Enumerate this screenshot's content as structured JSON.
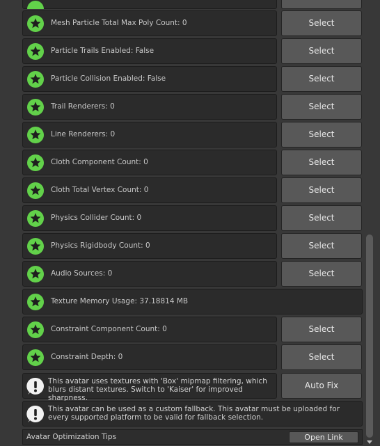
{
  "colors": {
    "ok_green": "#62d14a",
    "star": "#1e1e1e",
    "row_bg": "#2b2b2b",
    "button_bg": "#585858",
    "warn_circle": "#f2f2f2"
  },
  "rows": [
    {
      "label": "Mesh Particle Total Max Poly Count: 0",
      "button": "Select"
    },
    {
      "label": "Particle Trails Enabled: False",
      "button": "Select"
    },
    {
      "label": "Particle Collision Enabled: False",
      "button": "Select"
    },
    {
      "label": "Trail Renderers: 0",
      "button": "Select"
    },
    {
      "label": "Line Renderers: 0",
      "button": "Select"
    },
    {
      "label": "Cloth Component Count: 0",
      "button": "Select"
    },
    {
      "label": "Cloth Total Vertex Count: 0",
      "button": "Select"
    },
    {
      "label": "Physics Collider Count: 0",
      "button": "Select"
    },
    {
      "label": "Physics Rigidbody Count: 0",
      "button": "Select"
    },
    {
      "label": "Audio Sources: 0",
      "button": "Select"
    },
    {
      "label": "Texture Memory Usage: 37.18814 MB",
      "button": ""
    },
    {
      "label": "Constraint Component Count: 0",
      "button": "Select"
    },
    {
      "label": "Constraint Depth: 0",
      "button": "Select"
    }
  ],
  "top_partial_button": "Select",
  "warnings": [
    {
      "text": "This avatar uses textures with 'Box' mipmap filtering, which blurs distant textures. Switch to 'Kaiser' for improved sharpness.",
      "button": "Auto Fix"
    },
    {
      "text": "This avatar can be used as a custom fallback. This avatar must be uploaded for every supported platform to be valid for fallback selection.",
      "button": ""
    }
  ],
  "footer": {
    "title": "Avatar Optimization Tips",
    "button": "Open Link"
  },
  "icons": {
    "ok": "green-star-icon",
    "warning": "exclamation-icon"
  }
}
